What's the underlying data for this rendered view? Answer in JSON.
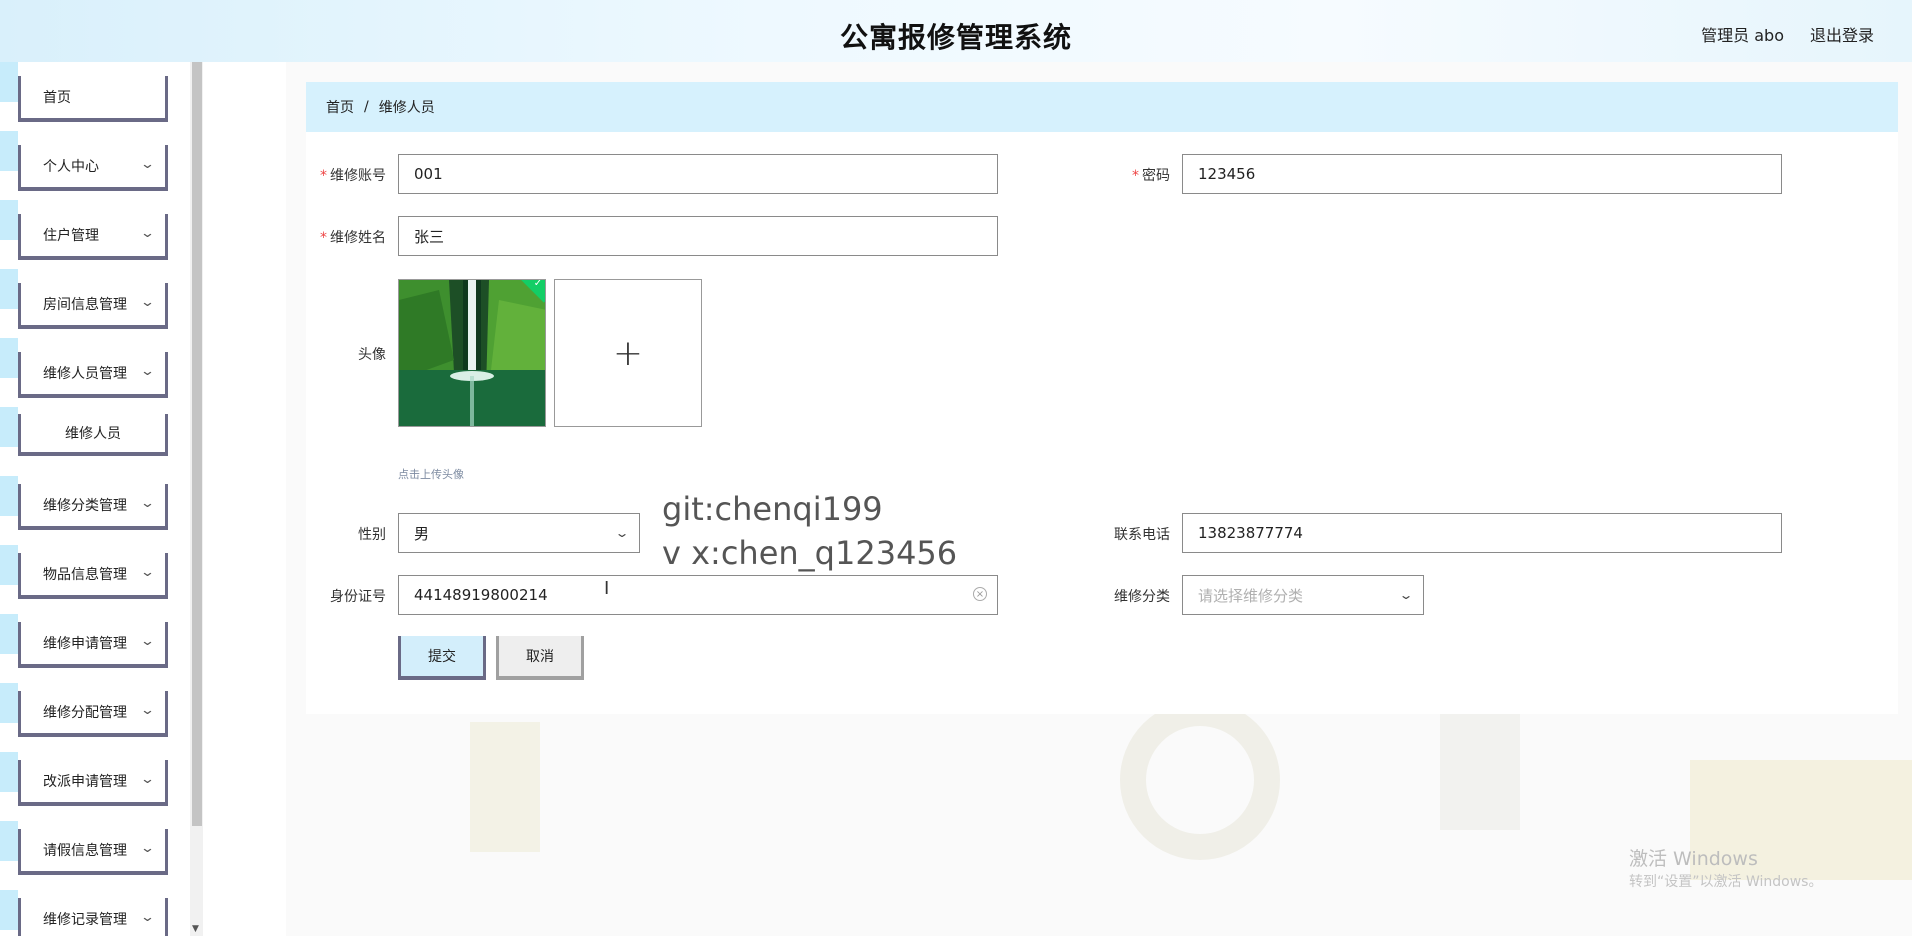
{
  "header": {
    "title": "公寓报修管理系统",
    "user": "管理员 abo",
    "logout": "退出登录"
  },
  "sidebar": {
    "items": [
      {
        "label": "首页"
      },
      {
        "label": "个人中心"
      },
      {
        "label": "住户管理"
      },
      {
        "label": "房间信息管理"
      },
      {
        "label": "维修人员管理"
      },
      {
        "label": "维修人员"
      },
      {
        "label": "维修分类管理"
      },
      {
        "label": "物品信息管理"
      },
      {
        "label": "维修申请管理"
      },
      {
        "label": "维修分配管理"
      },
      {
        "label": "改派申请管理"
      },
      {
        "label": "请假信息管理"
      },
      {
        "label": "维修记录管理"
      }
    ]
  },
  "breadcrumb": {
    "home": "首页",
    "separator": "/",
    "current": "维修人员"
  },
  "form": {
    "account": {
      "required": "*",
      "label": "维修账号",
      "value": "001"
    },
    "password": {
      "required": "*",
      "label": "密码",
      "value": "123456"
    },
    "name": {
      "required": "*",
      "label": "维修姓名",
      "value": "张三"
    },
    "avatar": {
      "label": "头像",
      "hint": "点击上传头像",
      "upload_symbol": "+"
    },
    "gender": {
      "label": "性别",
      "value": "男"
    },
    "phone": {
      "label": "联系电话",
      "value": "13823877774"
    },
    "id_card": {
      "label": "身份证号",
      "value": "44148919800214"
    },
    "category": {
      "label": "维修分类",
      "placeholder": "请选择维修分类"
    }
  },
  "buttons": {
    "submit": "提交",
    "cancel": "取消"
  },
  "overlay": {
    "line1": "git:chenqi199",
    "line2": "v x:chen_q123456"
  },
  "windows": {
    "activate": "激活 Windows",
    "sub": "转到“设置”以激活 Windows。"
  },
  "icons": {
    "chevron": "chevron-down-icon",
    "clear": "clear-icon",
    "check": "check-icon",
    "plus": "plus-icon"
  }
}
